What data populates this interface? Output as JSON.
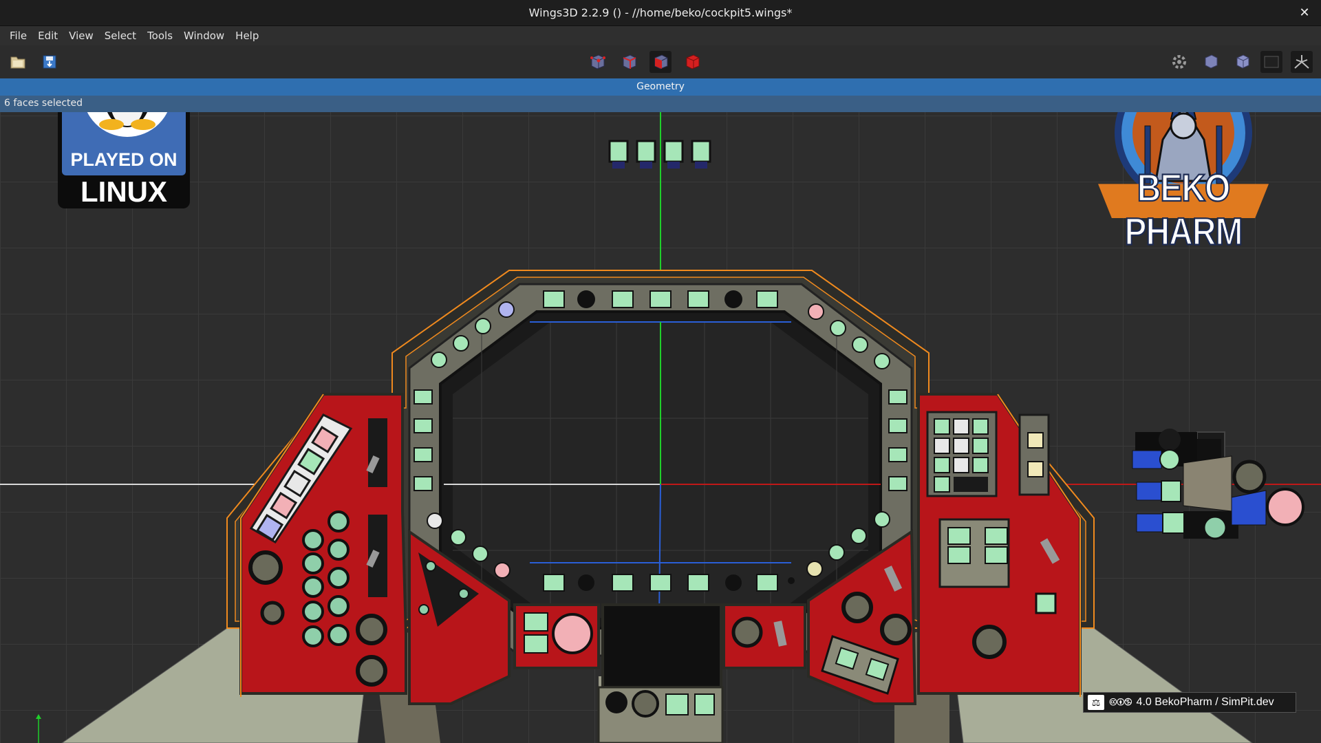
{
  "window": {
    "title": "Wings3D 2.2.9 () - //home/beko/cockpit5.wings*",
    "close_glyph": "✕"
  },
  "menu": {
    "items": [
      "File",
      "Edit",
      "View",
      "Select",
      "Tools",
      "Window",
      "Help"
    ]
  },
  "toolbar": {
    "left_icons": [
      "open-file-icon",
      "save-file-icon"
    ],
    "center_icons": [
      "vertex-select-icon",
      "edge-select-icon",
      "face-select-icon",
      "object-select-icon"
    ],
    "active_center_index": 2,
    "right_icons": [
      "settings-icon",
      "cube-wire-icon",
      "cube-shaded-icon",
      "background-icon",
      "perspective-icon"
    ]
  },
  "viewport": {
    "header": "Geometry",
    "status": "6 faces selected"
  },
  "overlays": {
    "badge_top": "PLAYED ON",
    "badge_bottom": "LINUX",
    "logo_text": "BEKO PHARM",
    "license_cc": "🅭🅯🄏",
    "license_text": "4.0 BekoPharm / SimPit.dev"
  },
  "colors": {
    "panel_red": "#b8151a",
    "frame_grey": "#3a3a34",
    "button_green": "#a6e6b8",
    "selection_orange": "#f08a1e",
    "header_blue": "#2f6fb0",
    "axis_green": "#1fcf2a",
    "axis_red": "#c01818",
    "axis_blue": "#2a5fd8"
  }
}
